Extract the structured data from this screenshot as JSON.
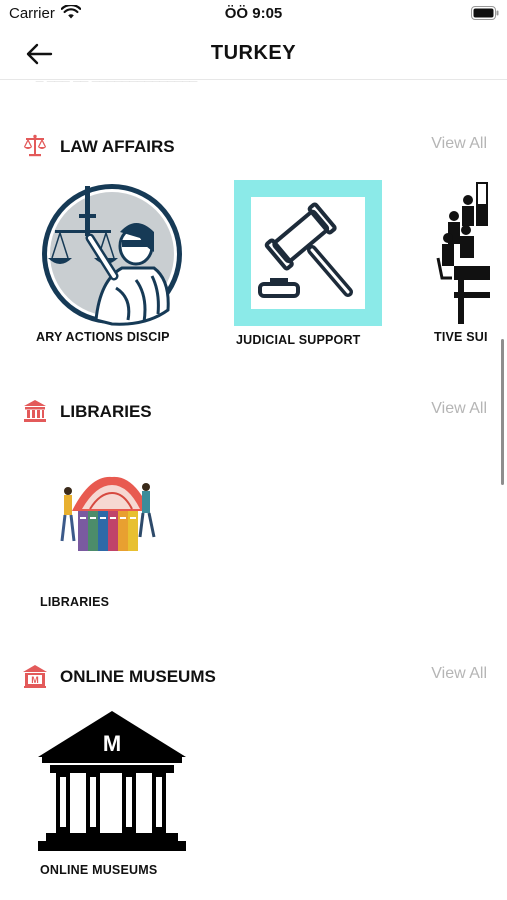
{
  "status_bar": {
    "carrier": "Carrier",
    "time": "ÖÖ 9:05"
  },
  "nav": {
    "title": "TURKEY",
    "back_icon": "arrow-left-icon"
  },
  "sections": {
    "law": {
      "title": "LAW AFFAIRS",
      "icon": "scales-icon",
      "view_all": "View All",
      "items": [
        {
          "label": "ARY ACTIONS   DISCIP",
          "icon": "lady-justice-icon"
        },
        {
          "label": "JUDICIAL SUPPORT",
          "icon": "gavel-icon"
        },
        {
          "label": "TIVE SUI",
          "icon": "courtroom-icon"
        }
      ]
    },
    "libraries": {
      "title": "LIBRARIES",
      "icon": "library-building-icon",
      "view_all": "View All",
      "items": [
        {
          "label": "LIBRARIES",
          "icon": "books-icon"
        }
      ]
    },
    "museums": {
      "title": "ONLINE MUSEUMS",
      "icon": "museum-icon",
      "view_all": "View All",
      "items": [
        {
          "label": "ONLINE MUSEUMS",
          "icon": "museum-building-icon",
          "emblem": "M"
        }
      ]
    }
  },
  "colors": {
    "accent": "#e35a5a",
    "view_all": "#b5b5b5",
    "cyan_frame": "#8beae8",
    "navy": "#163a56"
  }
}
